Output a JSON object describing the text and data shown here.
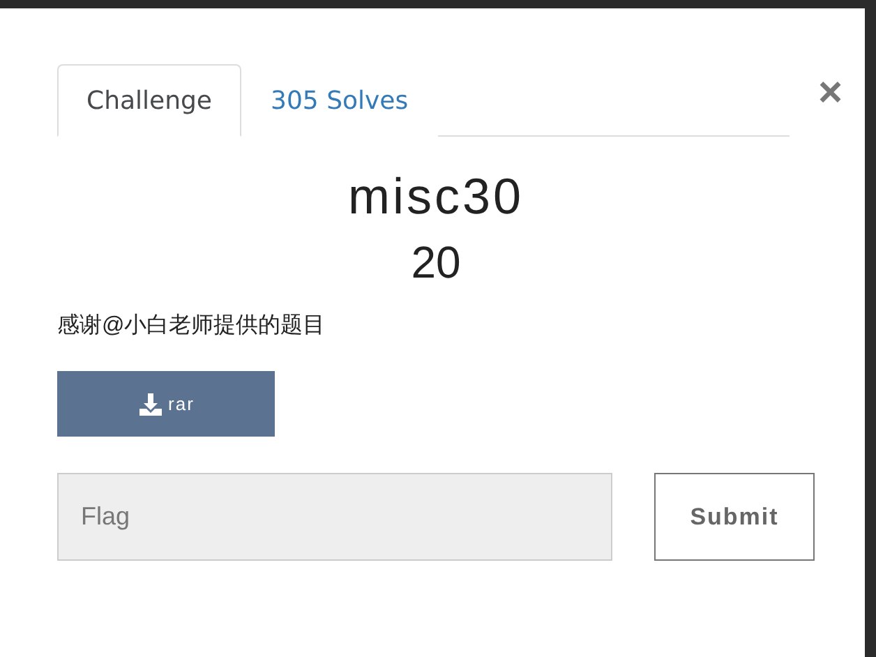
{
  "tabs": [
    {
      "label": "Challenge",
      "selected": true
    },
    {
      "label": "305 Solves",
      "selected": false
    }
  ],
  "close": "×",
  "challenge": {
    "name": "misc30",
    "value": "20",
    "description": "感谢@小白老师提供的题目"
  },
  "file_button": {
    "label": "rar"
  },
  "flag_field": {
    "placeholder": "Flag"
  },
  "submit_button": {
    "label": "Submit"
  }
}
